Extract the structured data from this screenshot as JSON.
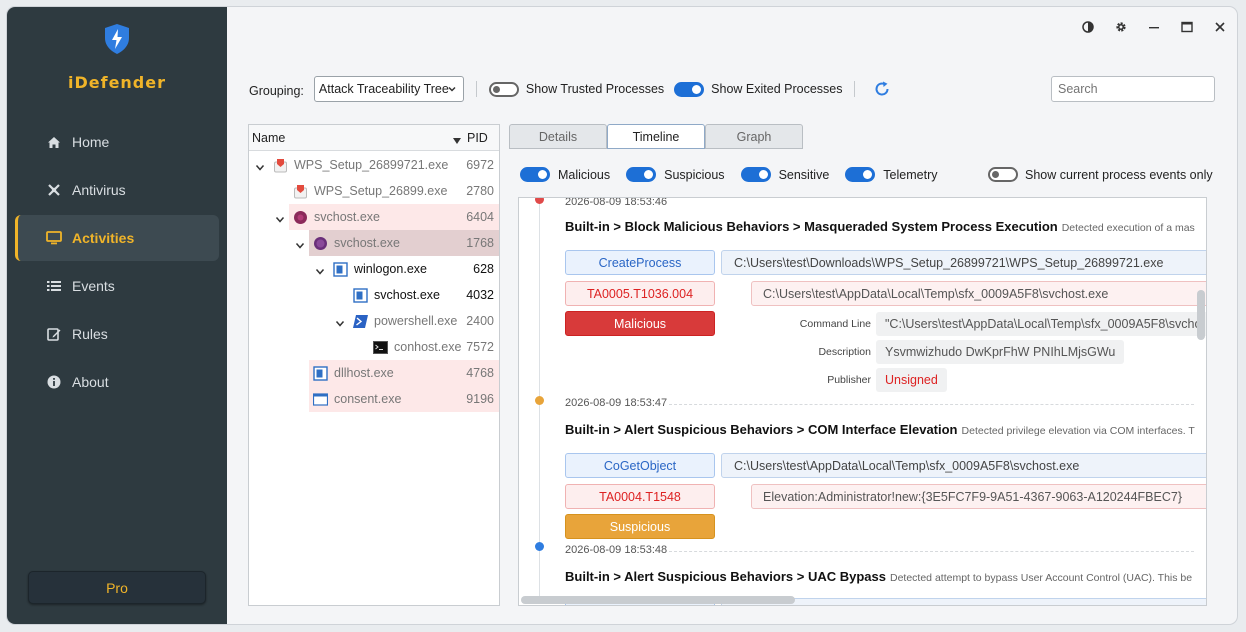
{
  "app": {
    "name": "iDefender"
  },
  "nav": [
    {
      "label": "Home",
      "icon": "home-icon",
      "active": false
    },
    {
      "label": "Antivirus",
      "icon": "antivirus-icon",
      "active": false
    },
    {
      "label": "Activities",
      "icon": "monitor-icon",
      "active": true
    },
    {
      "label": "Events",
      "icon": "list-icon",
      "active": false
    },
    {
      "label": "Rules",
      "icon": "edit-icon",
      "active": false
    },
    {
      "label": "About",
      "icon": "info-icon",
      "active": false
    }
  ],
  "pro_label": "Pro",
  "toolbar": {
    "grouping_label": "Grouping:",
    "grouping_value": "Attack Traceability Tree",
    "show_trusted_label": "Show Trusted Processes",
    "show_trusted_on": false,
    "show_exited_label": "Show Exited Processes",
    "show_exited_on": true,
    "search_placeholder": "Search"
  },
  "tree": {
    "col_name": "Name",
    "col_pid": "PID",
    "rows": [
      {
        "name": "WPS_Setup_26899721.exe",
        "pid": "6972"
      },
      {
        "name": "WPS_Setup_26899.exe",
        "pid": "2780"
      },
      {
        "name": "svchost.exe",
        "pid": "6404"
      },
      {
        "name": "svchost.exe",
        "pid": "1768"
      },
      {
        "name": "winlogon.exe",
        "pid": "628"
      },
      {
        "name": "svchost.exe",
        "pid": "4032"
      },
      {
        "name": "powershell.exe",
        "pid": "2400"
      },
      {
        "name": "conhost.exe",
        "pid": "7572"
      },
      {
        "name": "dllhost.exe",
        "pid": "4768"
      },
      {
        "name": "consent.exe",
        "pid": "9196"
      }
    ]
  },
  "tabs": [
    "Details",
    "Timeline",
    "Graph"
  ],
  "filters": {
    "malicious": "Malicious",
    "suspicious": "Suspicious",
    "sensitive": "Sensitive",
    "telemetry": "Telemetry",
    "current_only": "Show current process events only"
  },
  "events": [
    {
      "time": "2026-08-09 18:53:46",
      "title": "Built-in > Block Malicious Behaviors > Masqueraded System Process Execution",
      "desc": "Detected execution of a mas",
      "api": "CreateProcess",
      "api_path": "C:\\Users\\test\\Downloads\\WPS_Setup_26899721\\WPS_Setup_26899721.exe",
      "technique": "TA0005.T1036.004",
      "target": "C:\\Users\\test\\AppData\\Local\\Temp\\sfx_0009A5F8\\svchost.exe",
      "severity": "Malicious",
      "cmd_label": "Command Line",
      "cmd_value": "\"C:\\Users\\test\\AppData\\Local\\Temp\\sfx_0009A5F8\\svcho",
      "desc_label": "Description",
      "desc_value": "Ysvmwizhudo DwKprFhW PNIhLMjsGWu",
      "pub_label": "Publisher",
      "pub_value": "Unsigned",
      "color": "#e04a4a"
    },
    {
      "time": "2026-08-09 18:53:47",
      "title": "Built-in > Alert Suspicious Behaviors > COM Interface Elevation",
      "desc": "Detected privilege elevation via COM interfaces. T",
      "api": "CoGetObject",
      "api_path": "C:\\Users\\test\\AppData\\Local\\Temp\\sfx_0009A5F8\\svchost.exe",
      "technique": "TA0004.T1548",
      "target": "Elevation:Administrator!new:{3E5FC7F9-9A51-4367-9063-A120244FBEC7}",
      "severity": "Suspicious",
      "color": "#e8a43a"
    },
    {
      "time": "2026-08-09 18:53:48",
      "title": "Built-in > Alert Suspicious Behaviors > UAC Bypass",
      "desc": "Detected attempt to bypass User Account Control (UAC). This be",
      "color": "#2f7de0"
    }
  ]
}
